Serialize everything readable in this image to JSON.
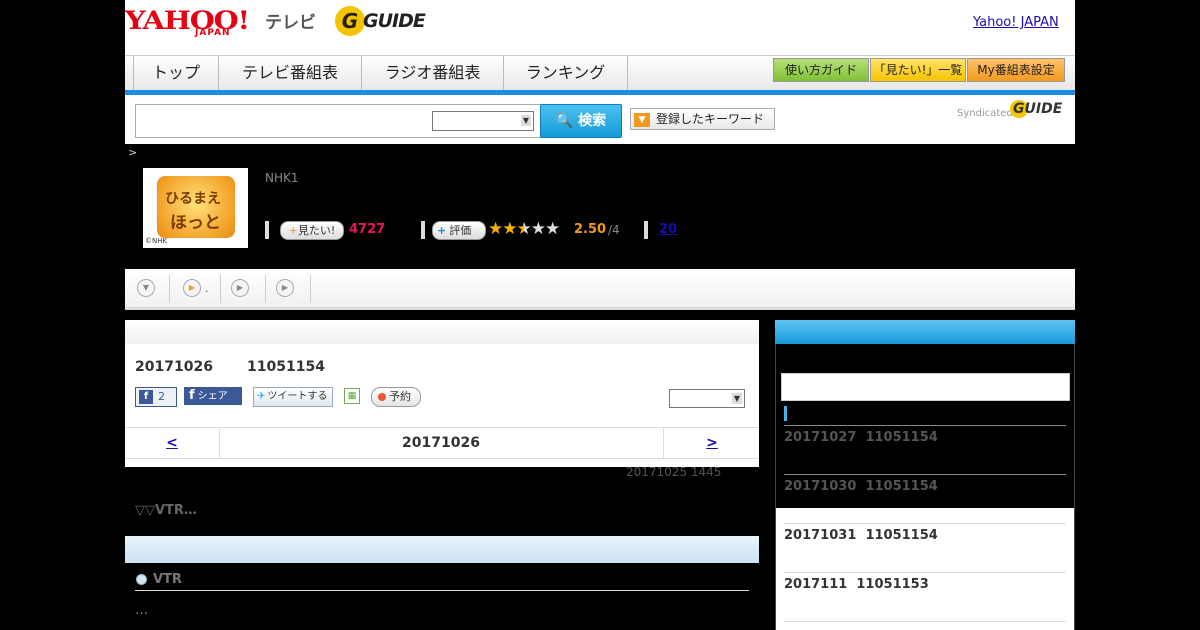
{
  "header": {
    "yahoo_logo": "YAHOO!",
    "yahoo_sub": "JAPAN",
    "tv_label": "テレビ",
    "gguide_logo": "GUIDE",
    "yahoo_japan_link": "Yahoo! JAPAN"
  },
  "nav": {
    "tabs": [
      "トップ",
      "テレビ番組表",
      "ラジオ番組表",
      "ランキング"
    ],
    "tools": [
      "使い方ガイド",
      "「見たい!」一覧",
      "My番組表設定"
    ]
  },
  "search": {
    "button_label": "検索",
    "keyword_button": "登録したキーワード",
    "syndicated": "Syndicated"
  },
  "program": {
    "breadcrumb": ">",
    "channel": "NHK1",
    "thumb_line1": "ひるまえ",
    "thumb_line2": "ほっと",
    "thumb_credit": "©NHK",
    "mitai_label": "見たい!",
    "mitai_count": "4727",
    "eval_label": "評価",
    "rating": "2.50",
    "rating_max": "/4",
    "rating_value": 2.5,
    "review_count": "20"
  },
  "tabs": {
    "tab2_suffix": "."
  },
  "main": {
    "air_date": "20171026",
    "air_id": "11051154",
    "fb_like_count": "2",
    "fb_share_label": "シェア",
    "tweet_label": "ツイートする",
    "reserve_label": "予約",
    "prev": "<",
    "nav_date": "20171026",
    "next": ">",
    "updated": "20171025  1445",
    "summary": "▽▽VTR…",
    "section_title": "VTR",
    "section_body": "…"
  },
  "sidebar": {
    "items": [
      {
        "date": "20171027",
        "id": "11051154"
      },
      {
        "date": "20171030",
        "id": "11051154"
      },
      {
        "date": "20171031",
        "id": "11051154"
      },
      {
        "date": "2017111",
        "id": "11051153"
      }
    ]
  },
  "colors": {
    "accent_blue": "#1b8ee0",
    "yahoo_red": "#e60012",
    "mitai_pink": "#e9155b",
    "rating_orange": "#f39a1e",
    "link_blue": "#1a0dab"
  }
}
